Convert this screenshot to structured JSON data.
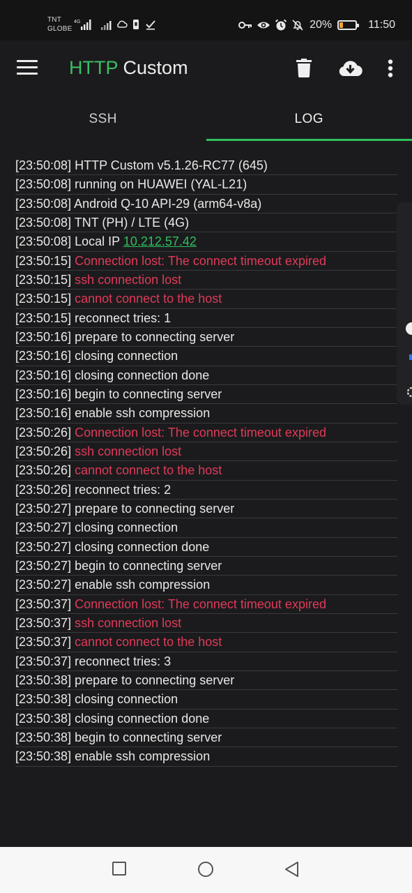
{
  "status_bar": {
    "carrier_line1": "TNT",
    "carrier_line2": "GLOBE",
    "network_type": "4G",
    "battery_percent": "20%",
    "battery_level": 0.2,
    "time": "11:50",
    "icons": [
      "signal-icon",
      "cloud-icon",
      "sim-icon",
      "download-done-icon",
      "key-icon",
      "eye-icon",
      "alarm-icon",
      "mute-icon",
      "battery-icon"
    ]
  },
  "toolbar": {
    "title_part1": "HTTP",
    "title_part2": "Custom",
    "title_color": "#3bbf62",
    "actions": [
      "trash-icon",
      "cloud-download-icon",
      "more-vert-icon"
    ]
  },
  "tabs": [
    {
      "label": "SSH",
      "active": false
    },
    {
      "label": "LOG",
      "active": true
    }
  ],
  "accent_color": "#2fbf5d",
  "error_color": "#e03a59",
  "log": [
    {
      "time": "[23:50:08]",
      "msg": "HTTP Custom v5.1.26-RC77 (645)",
      "type": "info"
    },
    {
      "time": "[23:50:08]",
      "msg": "running on HUAWEI (YAL-L21)",
      "type": "info"
    },
    {
      "time": "[23:50:08]",
      "msg": "Android Q-10 API-29 (arm64-v8a)",
      "type": "info"
    },
    {
      "time": "[23:50:08]",
      "msg": "TNT (PH) / LTE (4G)",
      "type": "info"
    },
    {
      "time": "[23:50:08]",
      "msg": "Local IP ",
      "link": "10.212.57.42",
      "type": "info"
    },
    {
      "time": "[23:50:15]",
      "msg": "Connection lost: The connect timeout expired",
      "type": "err"
    },
    {
      "time": "[23:50:15]",
      "msg": "ssh connection lost",
      "type": "err"
    },
    {
      "time": "[23:50:15]",
      "msg": "cannot connect to the host",
      "type": "err"
    },
    {
      "time": "[23:50:15]",
      "msg": "reconnect tries: 1",
      "type": "info"
    },
    {
      "time": "[23:50:16]",
      "msg": "prepare to connecting server",
      "type": "info"
    },
    {
      "time": "[23:50:16]",
      "msg": "closing connection",
      "type": "info"
    },
    {
      "time": "[23:50:16]",
      "msg": "closing connection done",
      "type": "info"
    },
    {
      "time": "[23:50:16]",
      "msg": "begin to connecting server",
      "type": "info"
    },
    {
      "time": "[23:50:16]",
      "msg": "enable ssh compression",
      "type": "info"
    },
    {
      "time": "[23:50:26]",
      "msg": "Connection lost: The connect timeout expired",
      "type": "err"
    },
    {
      "time": "[23:50:26]",
      "msg": "ssh connection lost",
      "type": "err"
    },
    {
      "time": "[23:50:26]",
      "msg": "cannot connect to the host",
      "type": "err"
    },
    {
      "time": "[23:50:26]",
      "msg": "reconnect tries: 2",
      "type": "info"
    },
    {
      "time": "[23:50:27]",
      "msg": "prepare to connecting server",
      "type": "info"
    },
    {
      "time": "[23:50:27]",
      "msg": "closing connection",
      "type": "info"
    },
    {
      "time": "[23:50:27]",
      "msg": "closing connection done",
      "type": "info"
    },
    {
      "time": "[23:50:27]",
      "msg": "begin to connecting server",
      "type": "info"
    },
    {
      "time": "[23:50:27]",
      "msg": "enable ssh compression",
      "type": "info"
    },
    {
      "time": "[23:50:37]",
      "msg": "Connection lost: The connect timeout expired",
      "type": "err"
    },
    {
      "time": "[23:50:37]",
      "msg": "ssh connection lost",
      "type": "err"
    },
    {
      "time": "[23:50:37]",
      "msg": "cannot connect to the host",
      "type": "err"
    },
    {
      "time": "[23:50:37]",
      "msg": "reconnect tries: 3",
      "type": "info"
    },
    {
      "time": "[23:50:38]",
      "msg": "prepare to connecting server",
      "type": "info"
    },
    {
      "time": "[23:50:38]",
      "msg": "closing connection",
      "type": "info"
    },
    {
      "time": "[23:50:38]",
      "msg": "closing connection done",
      "type": "info"
    },
    {
      "time": "[23:50:38]",
      "msg": "begin to connecting server",
      "type": "info"
    },
    {
      "time": "[23:50:38]",
      "msg": "enable ssh compression",
      "type": "info"
    }
  ],
  "nav_bar": [
    "recents-square-icon",
    "home-circle-icon",
    "back-triangle-icon"
  ]
}
